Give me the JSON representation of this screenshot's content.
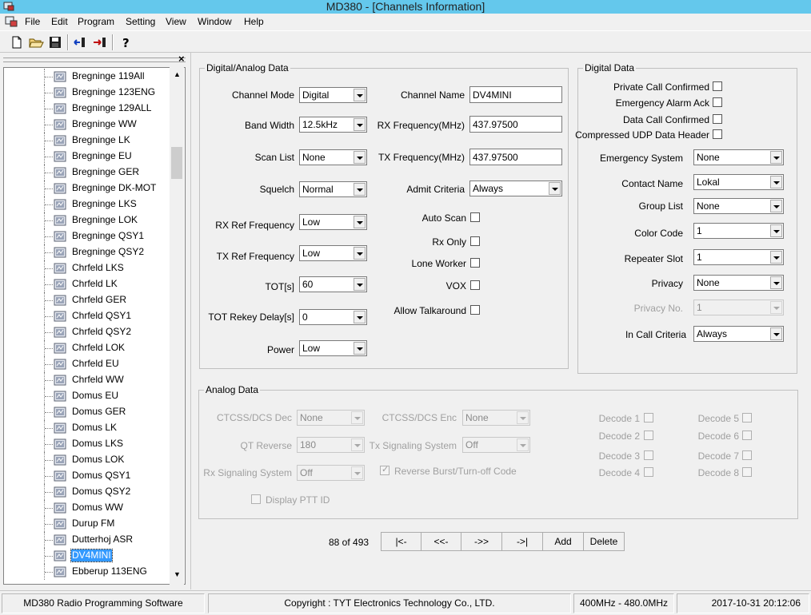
{
  "window": {
    "title": "MD380 - [Channels Information]"
  },
  "menu": [
    "File",
    "Edit",
    "Program",
    "Setting",
    "View",
    "Window",
    "Help"
  ],
  "toolbar": {
    "buttons": [
      "new-file-icon",
      "open-folder-icon",
      "save-icon",
      "read-from-radio-icon",
      "write-to-radio-icon",
      "help-icon"
    ]
  },
  "channel_tree": {
    "items": [
      "Bregninge 119All",
      "Bregninge 123ENG",
      "Bregninge 129ALL",
      "Bregninge WW",
      "Bregninge LK",
      "Bregninge EU",
      "Bregninge GER",
      "Bregninge DK-MOT",
      "Bregninge LKS",
      "Bregninge LOK",
      "Bregninge QSY1",
      "Bregninge QSY2",
      "Chrfeld LKS",
      "Chrfeld LK",
      "Chrfeld GER",
      "Chrfeld QSY1",
      "Chrfeld QSY2",
      "Chrfeld LOK",
      "Chrfeld EU",
      "Chrfeld WW",
      "Domus EU",
      "Domus GER",
      "Domus LK",
      "Domus LKS",
      "Domus LOK",
      "Domus QSY1",
      "Domus QSY2",
      "Domus WW",
      "Durup FM",
      "Dutterhoj ASR",
      "DV4MINI",
      "Ebberup 113ENG"
    ],
    "selected": "DV4MINI"
  },
  "digital_analog": {
    "title": "Digital/Analog Data",
    "channel_mode": {
      "label": "Channel Mode",
      "value": "Digital"
    },
    "band_width": {
      "label": "Band Width",
      "value": "12.5kHz"
    },
    "scan_list": {
      "label": "Scan List",
      "value": "None"
    },
    "squelch": {
      "label": "Squelch",
      "value": "Normal"
    },
    "rx_ref": {
      "label": "RX Ref Frequency",
      "value": "Low"
    },
    "tx_ref": {
      "label": "TX Ref Frequency",
      "value": "Low"
    },
    "tot": {
      "label": "TOT[s]",
      "value": "60"
    },
    "tot_rekey": {
      "label": "TOT Rekey Delay[s]",
      "value": "0"
    },
    "power": {
      "label": "Power",
      "value": "Low"
    },
    "channel_name": {
      "label": "Channel Name",
      "value": "DV4MINI"
    },
    "rx_freq": {
      "label": "RX Frequency(MHz)",
      "value": "437.97500"
    },
    "tx_freq": {
      "label": "TX Frequency(MHz)",
      "value": "437.97500"
    },
    "admit_criteria": {
      "label": "Admit Criteria",
      "value": "Always"
    },
    "auto_scan": {
      "label": "Auto Scan",
      "checked": false
    },
    "rx_only": {
      "label": "Rx Only",
      "checked": false
    },
    "lone_worker": {
      "label": "Lone Worker",
      "checked": false
    },
    "vox": {
      "label": "VOX",
      "checked": false
    },
    "allow_talkaround": {
      "label": "Allow Talkaround",
      "checked": false
    }
  },
  "digital": {
    "title": "Digital Data",
    "private_call": {
      "label": "Private Call Confirmed",
      "checked": false
    },
    "emergency_ack": {
      "label": "Emergency Alarm Ack",
      "checked": false
    },
    "data_call": {
      "label": "Data Call Confirmed",
      "checked": false
    },
    "compressed_udp": {
      "label": "Compressed UDP Data Header",
      "checked": false
    },
    "emergency_system": {
      "label": "Emergency System",
      "value": "None"
    },
    "contact_name": {
      "label": "Contact Name",
      "value": "Lokal"
    },
    "group_list": {
      "label": "Group List",
      "value": "None"
    },
    "color_code": {
      "label": "Color Code",
      "value": "1"
    },
    "repeater_slot": {
      "label": "Repeater Slot",
      "value": "1"
    },
    "privacy": {
      "label": "Privacy",
      "value": "None"
    },
    "privacy_no": {
      "label": "Privacy No.",
      "value": "1"
    },
    "in_call": {
      "label": "In Call Criteria",
      "value": "Always"
    }
  },
  "analog": {
    "title": "Analog Data",
    "ctcss_dec": {
      "label": "CTCSS/DCS Dec",
      "value": "None"
    },
    "ctcss_enc": {
      "label": "CTCSS/DCS Enc",
      "value": "None"
    },
    "qt_reverse": {
      "label": "QT Reverse",
      "value": "180"
    },
    "tx_signaling": {
      "label": "Tx Signaling System",
      "value": "Off"
    },
    "rx_signaling": {
      "label": "Rx Signaling System",
      "value": "Off"
    },
    "reverse_burst": {
      "label": "Reverse Burst/Turn-off Code",
      "checked": true
    },
    "display_ptt": {
      "label": "Display PTT ID",
      "checked": false
    },
    "decodes": [
      "Decode 1",
      "Decode 2",
      "Decode 3",
      "Decode 4",
      "Decode 5",
      "Decode 6",
      "Decode 7",
      "Decode 8"
    ]
  },
  "navigation": {
    "position": "88 of 493",
    "first": "|<-",
    "prev": "<<-",
    "next": "->>",
    "last": "->|",
    "add": "Add",
    "delete": "Delete"
  },
  "status": {
    "app": "MD380 Radio Programming Software",
    "copyright": "Copyright : TYT Electronics Technology Co., LTD.",
    "band": "400MHz - 480.0MHz",
    "datetime": "2017-10-31 20:12:06"
  }
}
